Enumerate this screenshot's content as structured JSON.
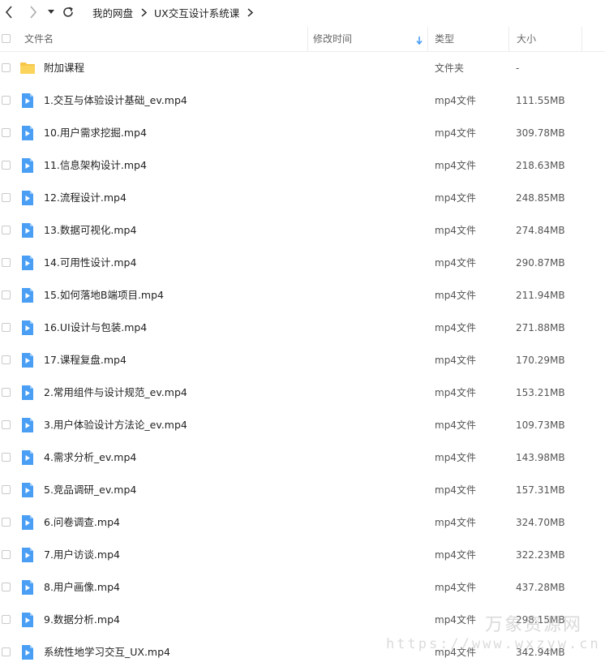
{
  "breadcrumb": {
    "items": [
      "我的网盘",
      "UX交互设计系统课"
    ]
  },
  "columns": {
    "name": "文件名",
    "modified": "修改时间",
    "type": "类型",
    "size": "大小"
  },
  "colors": {
    "folder": "#f7c547",
    "video": "#4a9ff5",
    "border": "#ececec",
    "sort_arrow": "#4a9ff5"
  },
  "files": [
    {
      "name": "附加课程",
      "type": "文件夹",
      "size": "-",
      "icon": "folder-icon"
    },
    {
      "name": "1.交互与体验设计基础_ev.mp4",
      "type": "mp4文件",
      "size": "111.55MB",
      "icon": "video-file-icon"
    },
    {
      "name": "10.用户需求挖掘.mp4",
      "type": "mp4文件",
      "size": "309.78MB",
      "icon": "video-file-icon"
    },
    {
      "name": "11.信息架构设计.mp4",
      "type": "mp4文件",
      "size": "218.63MB",
      "icon": "video-file-icon"
    },
    {
      "name": "12.流程设计.mp4",
      "type": "mp4文件",
      "size": "248.85MB",
      "icon": "video-file-icon"
    },
    {
      "name": "13.数据可视化.mp4",
      "type": "mp4文件",
      "size": "274.84MB",
      "icon": "video-file-icon"
    },
    {
      "name": "14.可用性设计.mp4",
      "type": "mp4文件",
      "size": "290.87MB",
      "icon": "video-file-icon"
    },
    {
      "name": "15.如何落地B端项目.mp4",
      "type": "mp4文件",
      "size": "211.94MB",
      "icon": "video-file-icon"
    },
    {
      "name": "16.UI设计与包装.mp4",
      "type": "mp4文件",
      "size": "271.88MB",
      "icon": "video-file-icon"
    },
    {
      "name": "17.课程复盘.mp4",
      "type": "mp4文件",
      "size": "170.29MB",
      "icon": "video-file-icon"
    },
    {
      "name": "2.常用组件与设计规范_ev.mp4",
      "type": "mp4文件",
      "size": "153.21MB",
      "icon": "video-file-icon"
    },
    {
      "name": "3.用户体验设计方法论_ev.mp4",
      "type": "mp4文件",
      "size": "109.73MB",
      "icon": "video-file-icon"
    },
    {
      "name": "4.需求分析_ev.mp4",
      "type": "mp4文件",
      "size": "143.98MB",
      "icon": "video-file-icon"
    },
    {
      "name": "5.竞品调研_ev.mp4",
      "type": "mp4文件",
      "size": "157.31MB",
      "icon": "video-file-icon"
    },
    {
      "name": "6.问卷调查.mp4",
      "type": "mp4文件",
      "size": "324.70MB",
      "icon": "video-file-icon"
    },
    {
      "name": "7.用户访谈.mp4",
      "type": "mp4文件",
      "size": "322.23MB",
      "icon": "video-file-icon"
    },
    {
      "name": "8.用户画像.mp4",
      "type": "mp4文件",
      "size": "437.28MB",
      "icon": "video-file-icon"
    },
    {
      "name": "9.数据分析.mp4",
      "type": "mp4文件",
      "size": "298.15MB",
      "icon": "video-file-icon"
    },
    {
      "name": "系统性地学习交互_UX.mp4",
      "type": "mp4文件",
      "size": "342.94MB",
      "icon": "video-file-icon"
    }
  ],
  "watermark": {
    "title": "万象资源网",
    "url": "https://www.wxzyw.cn"
  }
}
